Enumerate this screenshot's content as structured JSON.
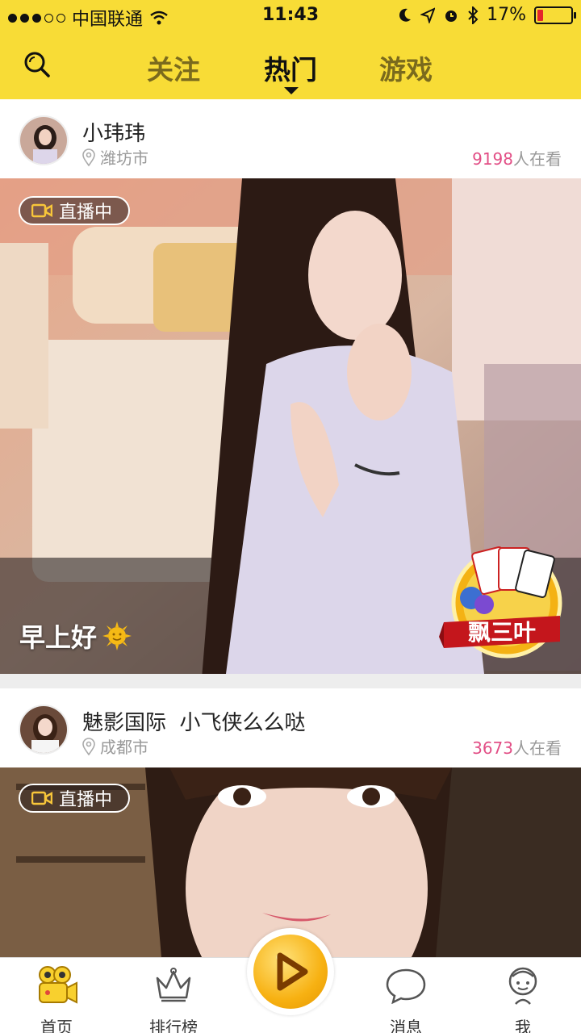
{
  "status_bar": {
    "carrier": "中国联通",
    "time": "11:43",
    "battery": "17%",
    "battery_level": 0.17
  },
  "nav": {
    "tabs": [
      {
        "label": "关注",
        "active": false
      },
      {
        "label": "热门",
        "active": true
      },
      {
        "label": "游戏",
        "active": false
      }
    ]
  },
  "feed": [
    {
      "username": "小玮玮",
      "location": "潍坊市",
      "viewers": "9198",
      "viewers_suffix": "人在看",
      "live_label": "直播中",
      "caption": "早上好",
      "game_badge": "飘三叶"
    },
    {
      "username": "魅影国际  小飞侠么么哒",
      "location": "成都市",
      "viewers": "3673",
      "viewers_suffix": "人在看",
      "live_label": "直播中"
    }
  ],
  "tabbar": {
    "items": [
      {
        "label": "首页",
        "icon": "camera-icon"
      },
      {
        "label": "排行榜",
        "icon": "crown-icon"
      },
      {
        "label": "",
        "icon": "play-icon"
      },
      {
        "label": "消息",
        "icon": "chat-icon"
      },
      {
        "label": "我",
        "icon": "person-icon"
      }
    ]
  },
  "colors": {
    "brand_yellow": "#f8dc36",
    "viewer_pink": "#e24f86"
  }
}
